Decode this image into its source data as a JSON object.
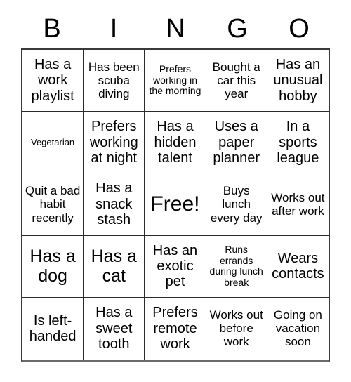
{
  "header": {
    "letters": [
      "B",
      "I",
      "N",
      "G",
      "O"
    ]
  },
  "grid": {
    "columns": 5,
    "rows": 5,
    "cells": [
      {
        "text": "Has a work playlist",
        "size": "fs-md"
      },
      {
        "text": "Has been scuba diving",
        "size": "fs-sm"
      },
      {
        "text": "Prefers working in the morning",
        "size": "fs-xs"
      },
      {
        "text": "Bought a car this year",
        "size": "fs-sm"
      },
      {
        "text": "Has an unusual hobby",
        "size": "fs-md"
      },
      {
        "text": "Vegetarian",
        "size": "fs-xxs"
      },
      {
        "text": "Prefers working at night",
        "size": "fs-md"
      },
      {
        "text": "Has a hidden talent",
        "size": "fs-md"
      },
      {
        "text": "Uses a paper planner",
        "size": "fs-md"
      },
      {
        "text": "In a sports league",
        "size": "fs-md"
      },
      {
        "text": "Quit a bad habit recently",
        "size": "fs-sm"
      },
      {
        "text": "Has a snack stash",
        "size": "fs-md"
      },
      {
        "text": "Free!",
        "size": "fs-xl"
      },
      {
        "text": "Buys lunch every day",
        "size": "fs-sm"
      },
      {
        "text": "Works out after work",
        "size": "fs-sm"
      },
      {
        "text": "Has a dog",
        "size": "fs-lg"
      },
      {
        "text": "Has a cat",
        "size": "fs-lg"
      },
      {
        "text": "Has an exotic pet",
        "size": "fs-md"
      },
      {
        "text": "Runs errands during lunch break",
        "size": "fs-xs"
      },
      {
        "text": "Wears contacts",
        "size": "fs-md"
      },
      {
        "text": "Is left-handed",
        "size": "fs-md"
      },
      {
        "text": "Has a sweet tooth",
        "size": "fs-md"
      },
      {
        "text": "Prefers remote work",
        "size": "fs-md"
      },
      {
        "text": "Works out before work",
        "size": "fs-sm"
      },
      {
        "text": "Going on vacation soon",
        "size": "fs-sm"
      }
    ]
  }
}
